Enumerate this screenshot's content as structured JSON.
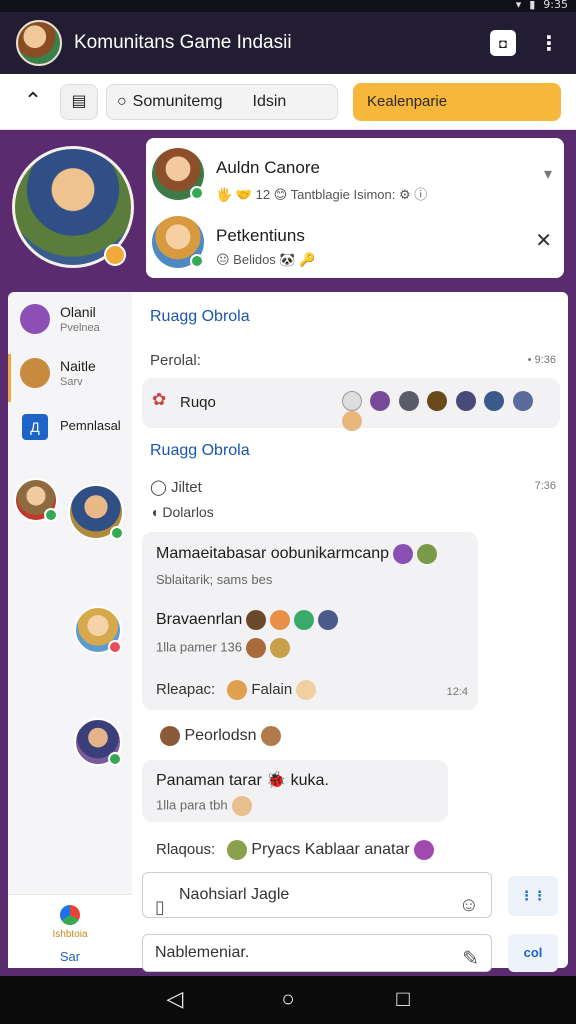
{
  "status": {
    "time": "9:35"
  },
  "appbar": {
    "title": "Komunitans Game Indasii",
    "camera_icon": "camera-icon",
    "more_icon": "more-vert-icon"
  },
  "toolbar": {
    "home_icon": "home-icon",
    "filter_icon": "filter-icon",
    "search_word1": "Somunitemg",
    "search_word2": "Idsin",
    "cta_label": "Kealenparie"
  },
  "cards": [
    {
      "name": "Auldn Canore",
      "meta": "🖐 🤝 12 😊 Tantblagie Isimon: ⚙ ⓘ",
      "ctrl": "▾"
    },
    {
      "name": "Petkentiuns",
      "meta": "😐 Belidos 🐼 🔑",
      "ctrl": "✕"
    }
  ],
  "sidebar": {
    "items": [
      {
        "title": "Olanil",
        "sub": "Pvelnea"
      },
      {
        "title": "Naitle",
        "sub": "Sarv"
      },
      {
        "title": "Pemnlasal",
        "sub": ""
      }
    ],
    "footer_l1": "Ishbtoia",
    "footer_l2": "Sar"
  },
  "chat": {
    "sec1": "Ruagg Obrola",
    "label_perolal": "Perolal:",
    "time1": "• 9:36",
    "ruqo_label": "Ruqo",
    "sec2": "Ruagg Obrola",
    "radio_label": "Jiltet",
    "time2": "7:36",
    "dolarlos": "Dolarlos",
    "msg1_line": "Mamaeitabasar oobunikarmcanp",
    "msg1_sub": "Sblaitarik; sams bes",
    "msg2_line": "Bravaenrlan",
    "msg2_sub": "1lla pamer 136",
    "msg2_reaction_label": "Rleapac:",
    "msg2_reaction_text": "Falain",
    "msg2_time": "12:4",
    "msg3_line": "Peorlodsn",
    "msg4_line": "Panaman tarar 🐞 kuka.",
    "msg4_sub": "1lla para tbh",
    "msg5_label": "Rlaqous:",
    "msg5_text": "Pryacs Kablaar anatar",
    "input1_placeholder": "Naohsiarl Jagle",
    "input2_placeholder": "Nablemeniar.",
    "send_label": "⋮⋮",
    "send2_label": "col"
  }
}
